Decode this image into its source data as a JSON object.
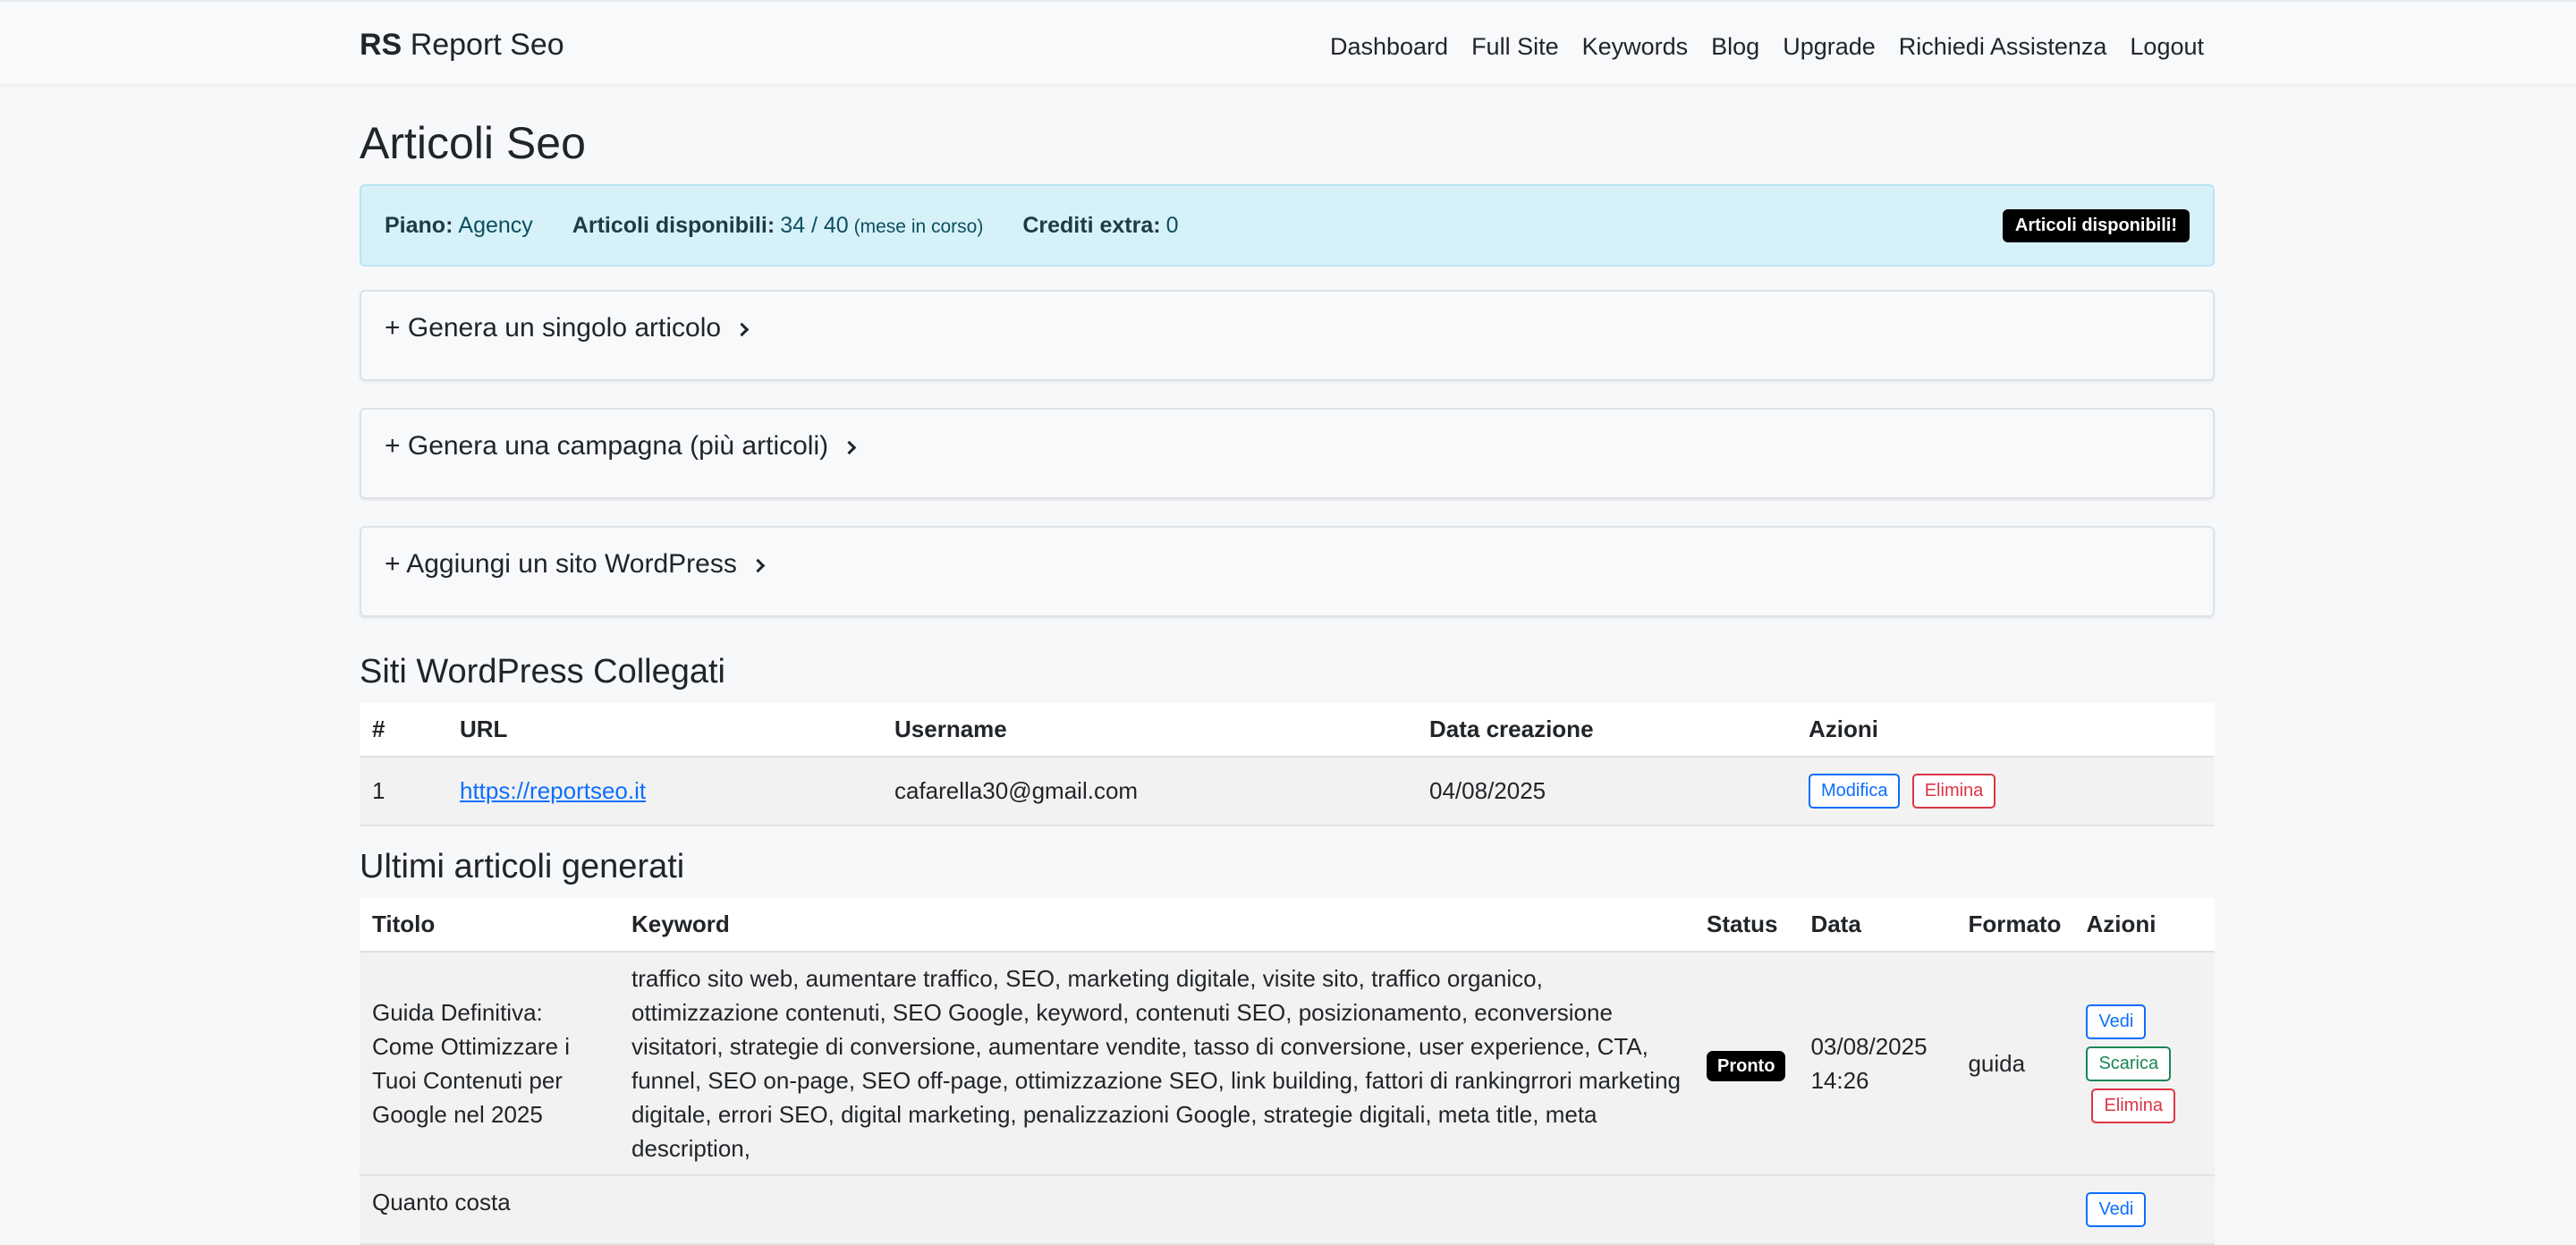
{
  "navbar": {
    "brand_mark": "RS",
    "brand_name": "Report Seo",
    "links": [
      "Dashboard",
      "Full Site",
      "Keywords",
      "Blog",
      "Upgrade",
      "Richiedi Assistenza",
      "Logout"
    ]
  },
  "page": {
    "title": "Articoli Seo"
  },
  "plan": {
    "piano_label": "Piano:",
    "piano_value": "Agency",
    "articoli_label": "Articoli disponibili:",
    "articoli_value": "34 / 40",
    "articoli_note": "(mese in corso)",
    "crediti_label": "Crediti extra:",
    "crediti_value": "0",
    "badge": "Articoli disponibili!"
  },
  "accordions": [
    "+ Genera un singolo articolo",
    "+ Genera una campagna (più articoli)",
    "+ Aggiungi un sito WordPress"
  ],
  "wp_sites": {
    "title": "Siti WordPress Collegati",
    "headers": [
      "#",
      "URL",
      "Username",
      "Data creazione",
      "Azioni"
    ],
    "rows": [
      {
        "num": "1",
        "url": "https://reportseo.it",
        "username": "cafarella30@gmail.com",
        "date": "04/08/2025",
        "edit": "Modifica",
        "delete": "Elimina"
      }
    ]
  },
  "articles": {
    "title": "Ultimi articoli generati",
    "headers": [
      "Titolo",
      "Keyword",
      "Status",
      "Data",
      "Formato",
      "Azioni"
    ],
    "rows": [
      {
        "title": "Guida Definitiva: Come Ottimizzare i Tuoi Contenuti per Google nel 2025",
        "keywords": "traffico sito web, aumentare traffico, SEO, marketing digitale, visite sito, traffico organico, ottimizzazione contenuti, SEO Google, keyword, contenuti SEO, posizionamento, econversione visitatori, strategie di conversione, aumentare vendite, tasso di conversione, user experience, CTA, funnel, SEO on-page, SEO off-page, ottimizzazione SEO, link building, fattori di rankingrrori marketing digitale, errori SEO, digital marketing, penalizzazioni Google, strategie digitali, meta title, meta description,",
        "status": "Pronto",
        "date": "03/08/2025",
        "time": "14:26",
        "format": "guida",
        "view": "Vedi",
        "download": "Scarica",
        "delete": "Elimina"
      },
      {
        "title": "Quanto costa",
        "view": "Vedi"
      }
    ]
  }
}
